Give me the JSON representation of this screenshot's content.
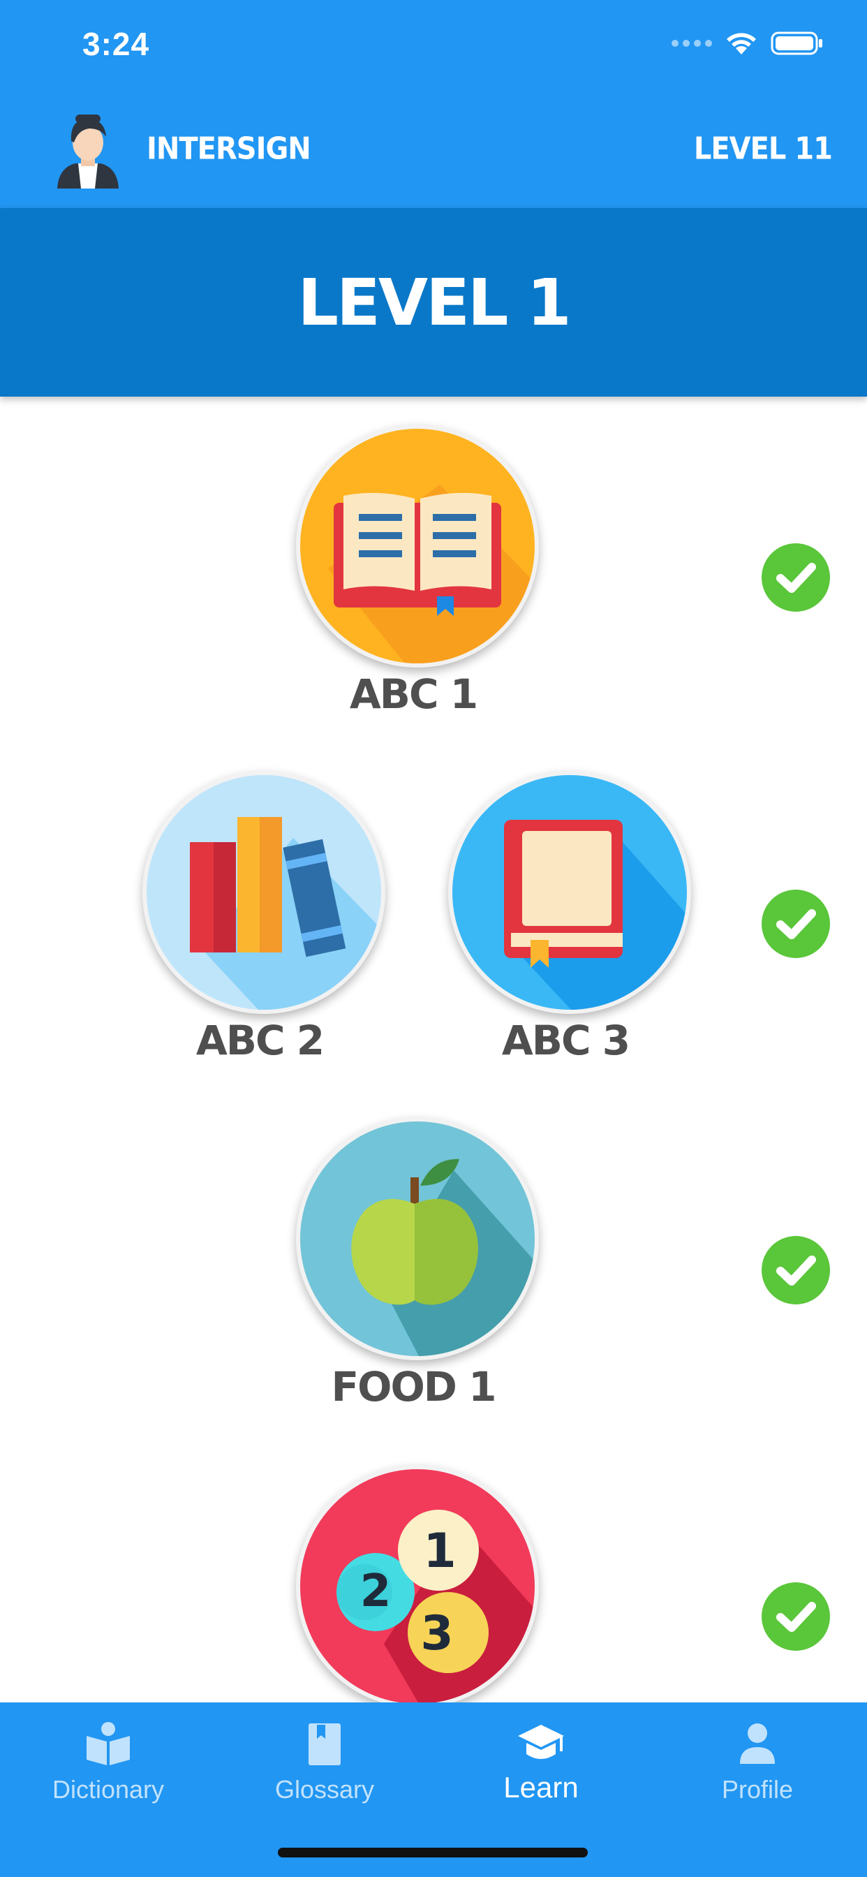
{
  "status_bar": {
    "time": "3:24"
  },
  "header": {
    "app_name": "INTERSIGN",
    "level": "LEVEL 11"
  },
  "banner": {
    "title": "LEVEL 1"
  },
  "lessons": {
    "abc1": {
      "label": "ABC 1",
      "completed": true
    },
    "abc2": {
      "label": "ABC 2",
      "completed": true
    },
    "abc3": {
      "label": "ABC 3",
      "completed": true
    },
    "food1": {
      "label": "FOOD 1",
      "completed": true
    },
    "numbers": {
      "label": "",
      "completed": true
    }
  },
  "tab_bar": {
    "dictionary": "Dictionary",
    "glossary": "Glossary",
    "learn": "Learn",
    "profile": "Profile",
    "active": "learn"
  },
  "colors": {
    "header_blue": "#2196f3",
    "banner_blue": "#0a78c8",
    "check_green": "#5ac63a",
    "label_gray": "#4f4f4f"
  }
}
